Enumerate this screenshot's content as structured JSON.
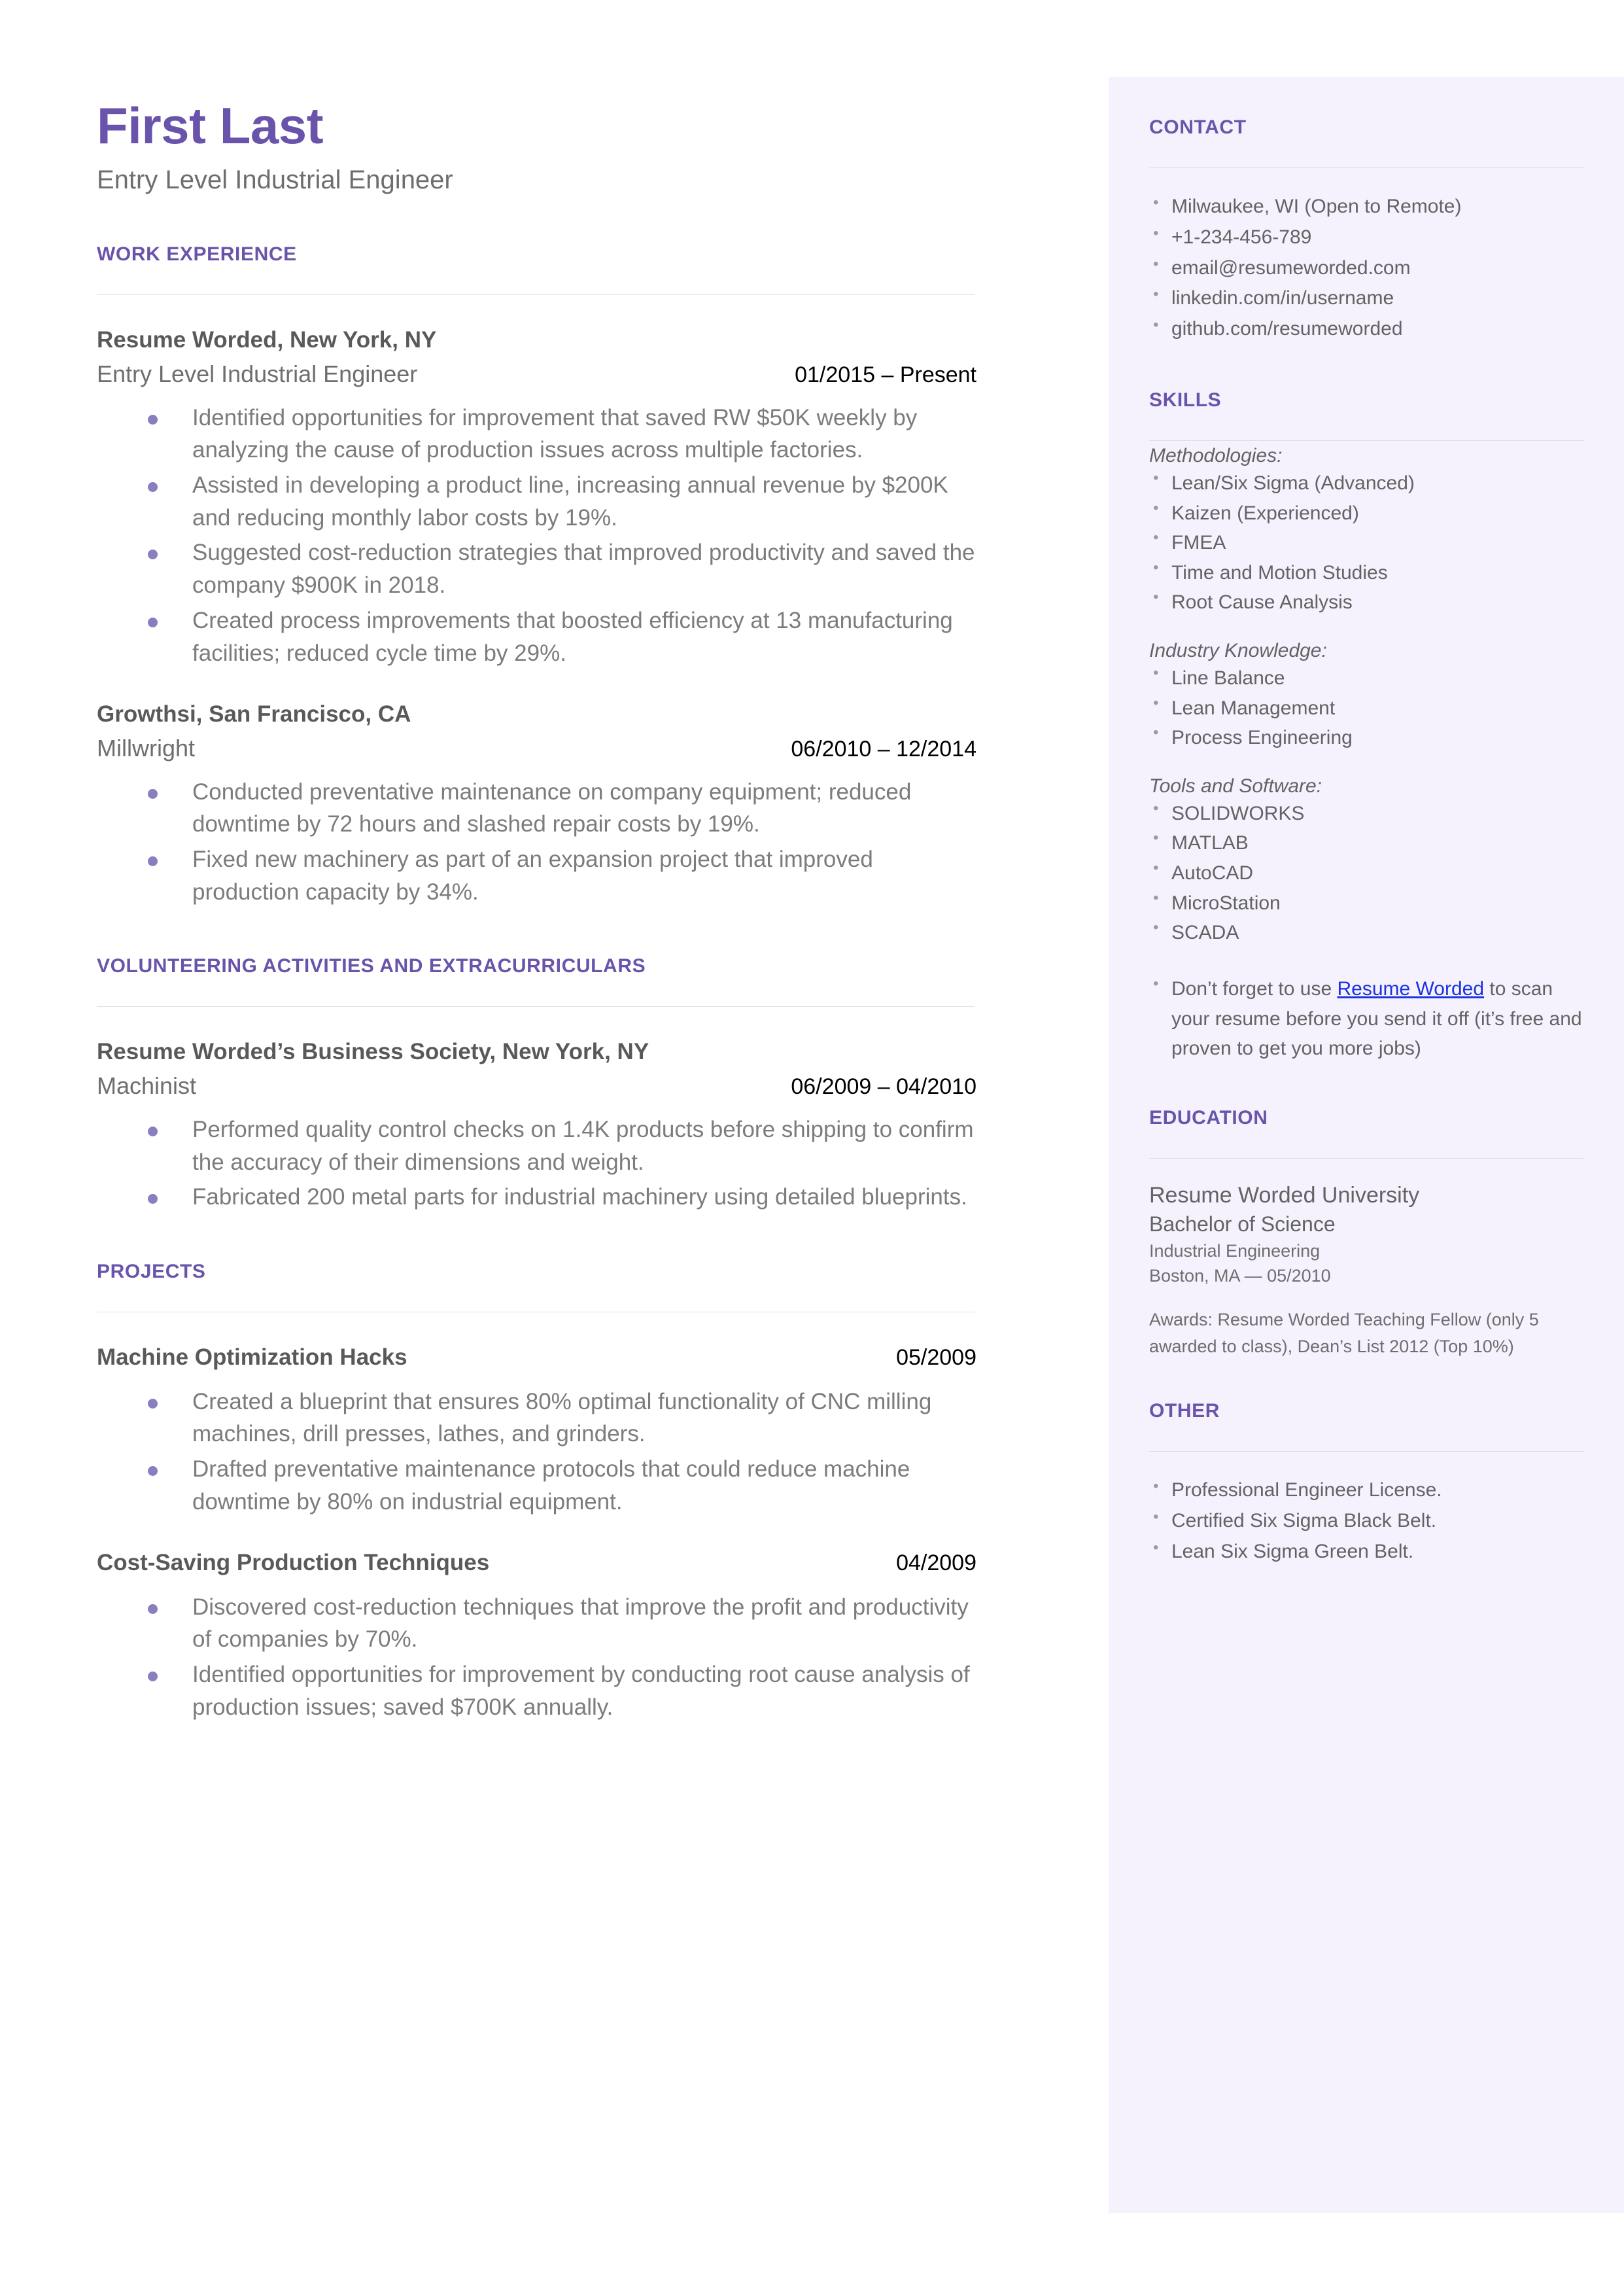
{
  "header": {
    "name": "First Last",
    "headline": "Entry Level Industrial Engineer"
  },
  "colors": {
    "accent": "#6a54ab",
    "sidebar_bg": "#f5f2fe",
    "bullet": "#8a7ec0",
    "link": "#1b33e0",
    "body_text": "#7c7c7c"
  },
  "main": {
    "sections": {
      "work_experience": {
        "heading": "WORK EXPERIENCE",
        "entries": [
          {
            "org": "Resume Worded, New York, NY",
            "role": "Entry Level Industrial Engineer",
            "date": "01/2015 – Present",
            "bullets": [
              "Identified opportunities for improvement that saved RW $50K weekly by analyzing the cause of production issues across multiple factories.",
              "Assisted in developing a product line, increasing annual revenue by $200K and reducing monthly labor costs by 19%.",
              "Suggested cost-reduction strategies that improved productivity and saved the company $900K in 2018.",
              "Created process improvements that boosted efficiency at 13 manufacturing facilities; reduced cycle time by 29%."
            ]
          },
          {
            "org": "Growthsi, San Francisco, CA",
            "role": "Millwright",
            "date": "06/2010 – 12/2014",
            "bullets": [
              "Conducted preventative maintenance on company equipment; reduced downtime by 72 hours and slashed repair costs by 19%.",
              "Fixed new machinery as part of an expansion project that improved production capacity by 34%."
            ]
          }
        ]
      },
      "volunteering": {
        "heading": "VOLUNTEERING ACTIVITIES AND EXTRACURRICULARS",
        "entries": [
          {
            "org": "Resume Worded’s Business Society, New York, NY",
            "role": "Machinist",
            "date": "06/2009 – 04/2010",
            "bullets": [
              "Performed quality control checks on 1.4K products before shipping to confirm the accuracy of their dimensions and weight.",
              "Fabricated 200 metal parts for industrial machinery using detailed blueprints."
            ]
          }
        ]
      },
      "projects": {
        "heading": "PROJECTS",
        "entries": [
          {
            "title": "Machine Optimization Hacks",
            "date": "05/2009",
            "bullets": [
              "Created a blueprint that ensures 80% optimal functionality of CNC milling machines, drill presses, lathes, and grinders.",
              "Drafted preventative maintenance protocols that could reduce machine downtime by 80% on industrial equipment."
            ]
          },
          {
            "title": "Cost-Saving Production Techniques",
            "date": "04/2009",
            "bullets": [
              "Discovered cost-reduction techniques that improve the profit and productivity of companies by 70%.",
              "Identified opportunities for improvement by conducting root cause analysis of production issues; saved $700K annually."
            ]
          }
        ]
      }
    }
  },
  "sidebar": {
    "contact": {
      "heading": "CONTACT",
      "items": [
        "Milwaukee, WI (Open to Remote)",
        "+1-234-456-789",
        "email@resumeworded.com",
        "linkedin.com/in/username",
        "github.com/resumeworded"
      ]
    },
    "skills": {
      "heading": "SKILLS",
      "groups": [
        {
          "label": "Methodologies:",
          "items": [
            "Lean/Six Sigma (Advanced)",
            "Kaizen (Experienced)",
            "FMEA",
            "Time and Motion Studies",
            "Root Cause Analysis"
          ]
        },
        {
          "label": "Industry Knowledge:",
          "items": [
            "Line Balance",
            "Lean Management",
            "Process Engineering"
          ]
        },
        {
          "label": "Tools and Software:",
          "items": [
            "SOLIDWORKS",
            "MATLAB",
            "AutoCAD",
            "MicroStation",
            "SCADA"
          ]
        }
      ],
      "promo": {
        "prefix": "Don’t forget to use ",
        "link": "Resume Worded",
        "suffix": " to scan your resume before you send it off (it’s free and proven to get you more jobs)"
      }
    },
    "education": {
      "heading": "EDUCATION",
      "school": "Resume Worded University",
      "degree": "Bachelor of Science",
      "field": "Industrial Engineering",
      "place": "Boston, MA — 05/2010",
      "awards": "Awards: Resume Worded Teaching Fellow (only 5 awarded to class), Dean’s List 2012 (Top 10%)"
    },
    "other": {
      "heading": "OTHER",
      "items": [
        "Professional Engineer License.",
        "Certified Six Sigma Black Belt.",
        "Lean Six Sigma Green Belt."
      ]
    }
  }
}
